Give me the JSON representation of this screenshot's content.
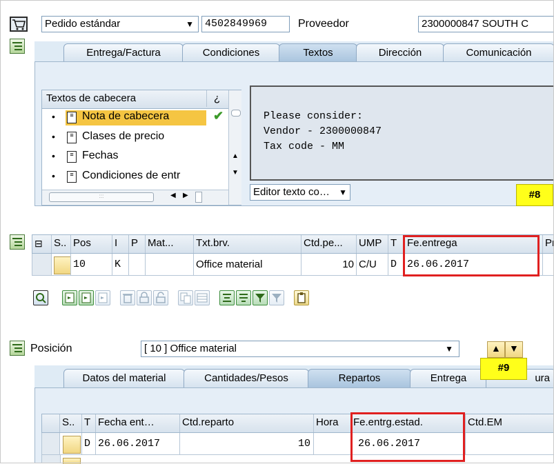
{
  "header": {
    "doc_type": "Pedido estándar",
    "po_number": "4502849969",
    "vendor_label": "Proveedor",
    "vendor_value": "2300000847 SOUTH C"
  },
  "header_tabs": [
    "Entrega/Factura",
    "Condiciones",
    "Textos",
    "Dirección",
    "Comunicación"
  ],
  "texts": {
    "tree_header": "Textos de cabecera",
    "tree_header_col2": "¿",
    "items": [
      "Nota de cabecera",
      "Clases de precio",
      "Fechas",
      "Condiciones de entr"
    ],
    "editor_lines": [
      "Please consider:",
      "Vendor - 2300000847",
      "Tax code - MM"
    ],
    "editor_select": "Editor texto co…"
  },
  "callouts": {
    "c8": "#8",
    "c9": "#9"
  },
  "items_grid": {
    "headers": [
      "S..",
      "Pos",
      "I",
      "P",
      "Mat...",
      "Txt.brv.",
      "Ctd.pe...",
      "UMP",
      "T",
      "Fe.entrega",
      "Pr"
    ],
    "row": {
      "pos": "10",
      "i": "K",
      "txt": "Office material",
      "qty": "10",
      "unit": "C/U",
      "t": "D",
      "date": "26.06.2017"
    }
  },
  "item_detail": {
    "label": "Posición",
    "selected": "[ 10 ] Office material"
  },
  "item_tabs": [
    "Datos del material",
    "Cantidades/Pesos",
    "Repartos",
    "Entrega",
    "ura"
  ],
  "schedule_grid": {
    "headers": [
      "S..",
      "T",
      "Fecha ent…",
      "Ctd.reparto",
      "Hora",
      "Fe.entrg.estad.",
      "Ctd.EM"
    ],
    "row": {
      "t": "D",
      "date": "26.06.2017",
      "qty": "10",
      "stat_date": "26.06.2017"
    }
  }
}
